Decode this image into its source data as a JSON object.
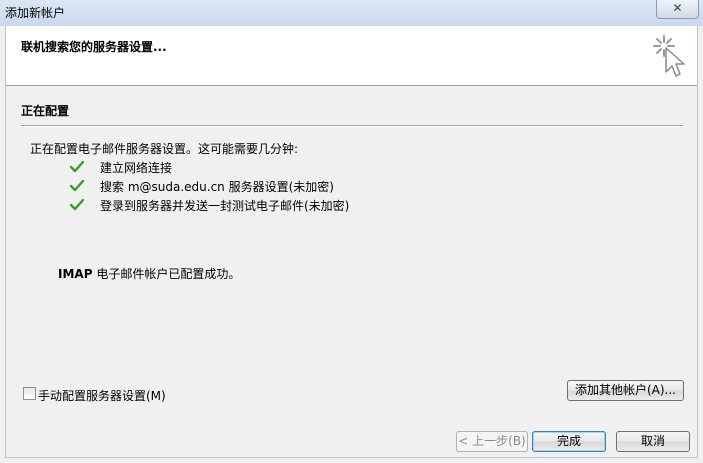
{
  "window": {
    "title": "添加新帐户",
    "close_glyph": "✕"
  },
  "header": {
    "title": "联机搜索您的服务器设置..."
  },
  "section": {
    "title": "正在配置",
    "intro": "正在配置电子邮件服务器设置。这可能需要几分钟:",
    "steps": [
      {
        "label": "建立网络连接",
        "status": "done"
      },
      {
        "label": "搜索 m@suda.edu.cn 服务器设置(未加密)",
        "status": "done"
      },
      {
        "label": "登录到服务器并发送一封测试电子邮件(未加密)",
        "status": "done"
      }
    ],
    "success_protocol": "IMAP",
    "success_text": " 电子邮件帐户已配置成功。"
  },
  "options": {
    "manual_config_label": "手动配置服务器设置(M)",
    "manual_config_checked": false,
    "add_other_account_label": "添加其他帐户(A)..."
  },
  "footer": {
    "back_label": "< 上一步(B)",
    "finish_label": "完成",
    "cancel_label": "取消"
  },
  "colors": {
    "check_green": "#3a9b2a",
    "titlebar": "#c7d9ec"
  },
  "icons": {
    "busy": "busy-cursor-icon",
    "check": "checkmark-icon",
    "close": "close-icon"
  }
}
